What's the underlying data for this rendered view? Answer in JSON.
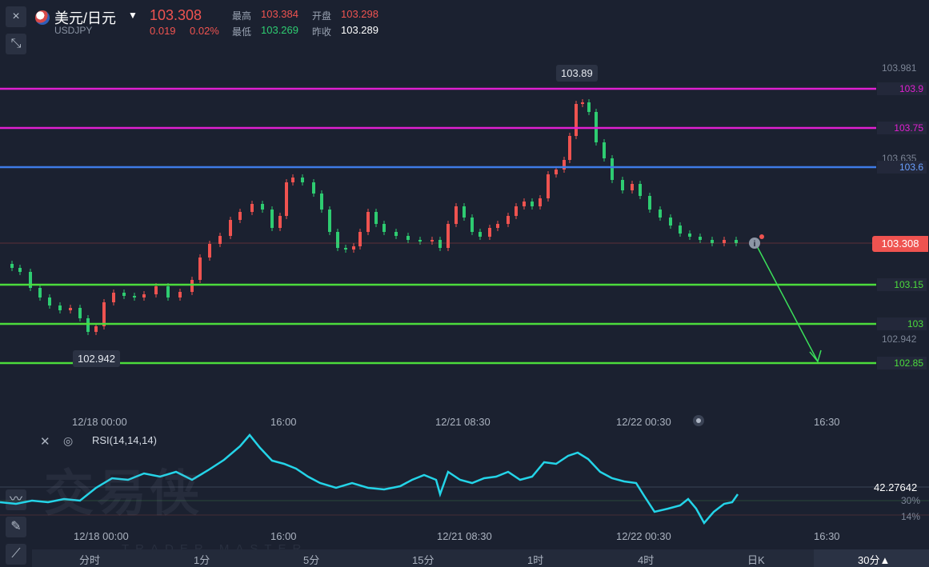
{
  "toolbar": {
    "close_icon": "×",
    "collapse_icon": "⤡",
    "chart_icon": "〰",
    "draw_icon": "✎",
    "indicator_icon": "⟋"
  },
  "quote": {
    "name": "美元/日元",
    "symbol": "USDJPY",
    "price": "103.308",
    "change": "0.019",
    "change_pct": "0.02%",
    "high_label": "最高",
    "high": "103.384",
    "open_label": "开盘",
    "open": "103.298",
    "low_label": "最低",
    "low": "103.269",
    "prev_label": "昨收",
    "prev_close": "103.289"
  },
  "price_axis": {
    "top": "103.981",
    "upper_mid": "103.635",
    "lower_mid": "102.942"
  },
  "levels": [
    {
      "value": "103.9",
      "color": "#e020d0"
    },
    {
      "value": "103.75",
      "color": "#e020d0"
    },
    {
      "value": "103.6",
      "color": "#3e7be6"
    },
    {
      "value": "103.15",
      "color": "#4cdc3c"
    },
    {
      "value": "103",
      "color": "#4cdc3c"
    },
    {
      "value": "102.85",
      "color": "#4cdc3c"
    }
  ],
  "current_price_tag": "103.308",
  "annotations": {
    "high_callout": "103.89",
    "low_callout": "102.942"
  },
  "time_axis": [
    "12/18 00:00",
    "16:00",
    "12/21 08:30",
    "12/22 00:30",
    "16:30"
  ],
  "rsi": {
    "title": "RSI(14,14,14)",
    "value": "42.27642",
    "level_30": "30%",
    "level_14": "14%"
  },
  "timeframes": [
    "分时",
    "1分",
    "5分",
    "15分",
    "1时",
    "4时",
    "日K",
    "30分▲"
  ],
  "watermark": {
    "main": "交易侠",
    "sub": "TRADER MASTER"
  },
  "colors": {
    "up": "#ef5350",
    "down": "#2ecc71",
    "rsi_line": "#24d4e8",
    "background": "#1b2130"
  }
}
